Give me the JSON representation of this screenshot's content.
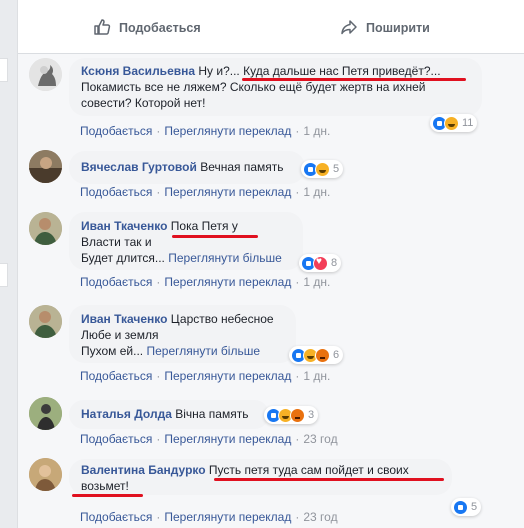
{
  "actions": {
    "like_label": "Подобається",
    "share_label": "Поширити"
  },
  "comments": [
    {
      "author": "Ксюня Васильевна",
      "text_1": "Ну и?...",
      "text_2": "Куда дальше нас Петя приведёт?...",
      "text_3": "Покамисть все не ляжем? Сколько ещё будет жертв на ихней совести? Которой нет!",
      "like": "Подобається",
      "translate": "Переглянути переклад",
      "time": "1 дн.",
      "reactions": [
        "like",
        "haha"
      ],
      "count": "11"
    },
    {
      "author": "Вячеслав Гуртовой",
      "text_1": "Вечная память",
      "like": "Подобається",
      "translate": "Переглянути переклад",
      "time": "1 дн.",
      "reactions": [
        "like",
        "haha"
      ],
      "count": "5"
    },
    {
      "author": "Иван Ткаченко",
      "text_1": "Пока Петя у",
      "text_2": "Власти так и",
      "text_3": "Будет длится...",
      "more": "Переглянути більше",
      "like": "Подобається",
      "translate": "Переглянути переклад",
      "time": "1 дн.",
      "reactions": [
        "like",
        "love"
      ],
      "count": "8"
    },
    {
      "author": "Иван Ткаченко",
      "text_1": "Царство небесное",
      "text_2": "Любе и земля",
      "text_3": "Пухом ей...",
      "more": "Переглянути більше",
      "like": "Подобається",
      "translate": "Переглянути переклад",
      "time": "1 дн.",
      "reactions": [
        "like",
        "haha",
        "angry"
      ],
      "count": "6"
    },
    {
      "author": "Наталья Долда",
      "text_1": "Вічна память",
      "like": "Подобається",
      "translate": "Переглянути переклад",
      "time": "23 год",
      "reactions": [
        "like",
        "haha",
        "angry"
      ],
      "count": "3"
    },
    {
      "author": "Валентина Бандурко",
      "text_1": "Пусть петя туда сам пойдет и своих",
      "text_2": "возьмет!",
      "like": "Подобається",
      "translate": "Переглянути переклад",
      "time": "23 год",
      "reactions": [
        "like"
      ],
      "count": "5"
    }
  ],
  "colors": {
    "link": "#385898",
    "meta": "#90949c",
    "underline": "#e0101f",
    "bubble": "#f2f3f5"
  }
}
